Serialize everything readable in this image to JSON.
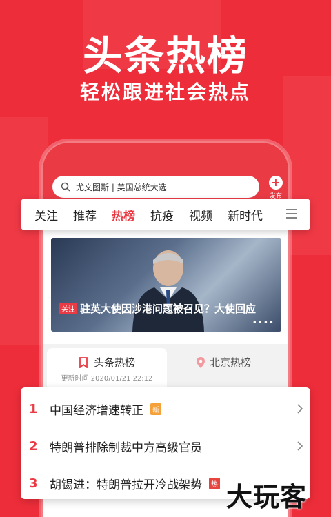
{
  "promo": {
    "headline": "头条热榜",
    "subheadline": "轻松跟进社会热点"
  },
  "search": {
    "text": "尤文图斯 | 美国总统大选",
    "publish_label": "发布"
  },
  "nav_tabs": [
    {
      "label": "关注"
    },
    {
      "label": "推荐"
    },
    {
      "label": "热榜",
      "active": true
    },
    {
      "label": "抗疫"
    },
    {
      "label": "视频"
    },
    {
      "label": "新时代"
    }
  ],
  "banner": {
    "tag": "关注",
    "headline": "驻英大使因涉港问题被召见？大使回应",
    "dots": "••••"
  },
  "hot_tabs": {
    "active_label": "头条热榜",
    "updated": "更新时间 2020/01/21 22:12",
    "other_label": "北京热榜"
  },
  "hot_list": [
    {
      "rank": "1",
      "title": "中国经济增速转正",
      "badge": "新"
    },
    {
      "rank": "2",
      "title": "特朗普排除制裁中方高级官员",
      "badge": ""
    },
    {
      "rank": "3",
      "title": "胡锡进：特朗普拉开冷战架势",
      "badge": "热"
    }
  ],
  "watermark": "大玩客",
  "colors": {
    "brand_red": "#ee2d3a",
    "accent_red": "#ea3b45",
    "badge_new": "#f5a13a",
    "badge_hot": "#e8443f"
  }
}
